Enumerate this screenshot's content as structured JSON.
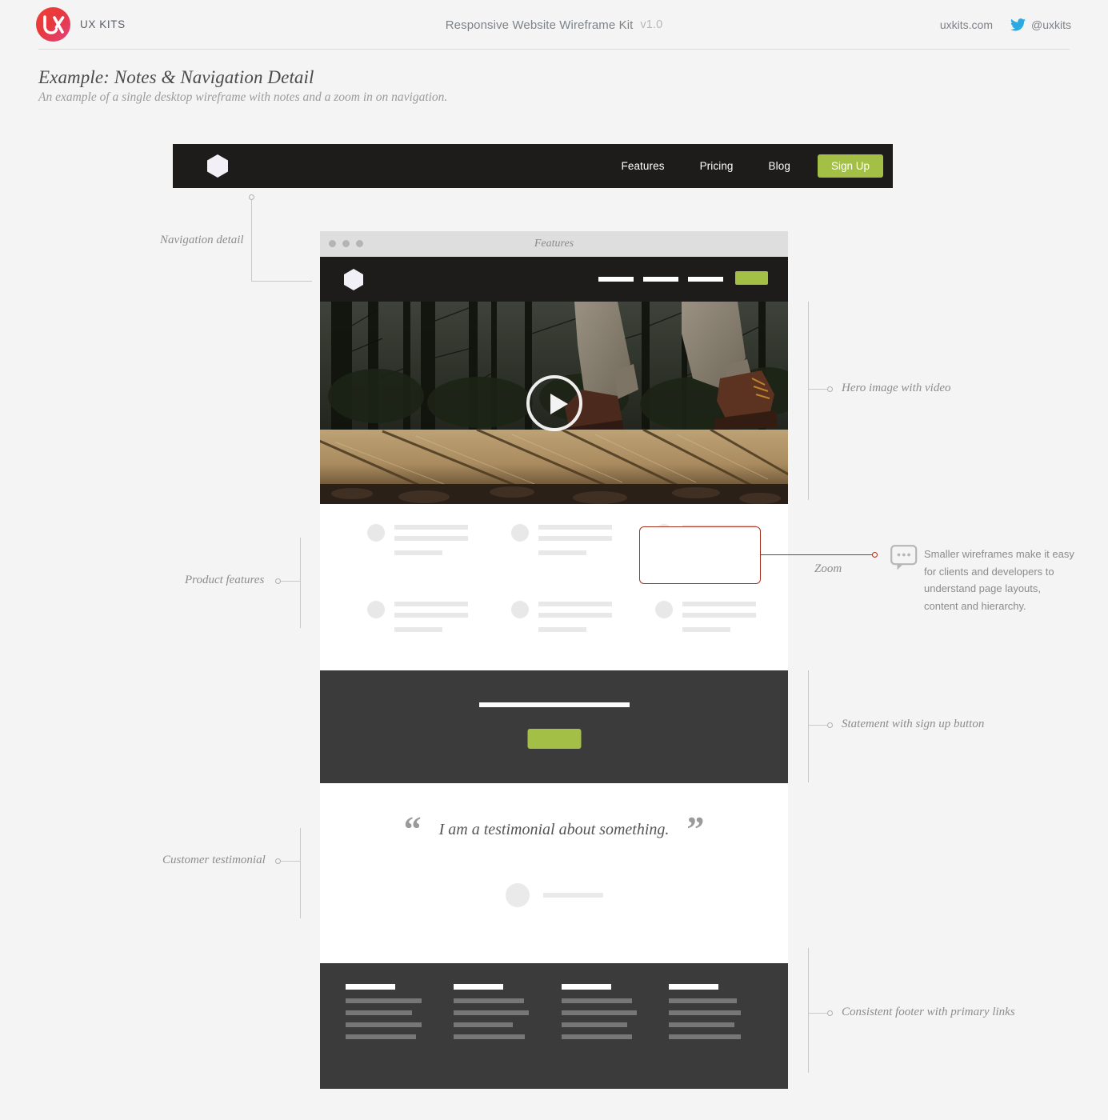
{
  "topbar": {
    "brand": "UX KITS",
    "kit_title": "Responsive Website Wireframe Kit",
    "version": "v1.0",
    "website": "uxkits.com",
    "twitter_handle": "@uxkits"
  },
  "page": {
    "title": "Example: Notes & Navigation Detail",
    "subtitle": "An example of a single desktop wireframe with notes and a zoom in on navigation."
  },
  "nav_detail": {
    "links": [
      "Features",
      "Pricing",
      "Blog"
    ],
    "cta": "Sign Up"
  },
  "browser": {
    "window_title": "Features"
  },
  "annotations": {
    "navigation_detail": "Navigation detail",
    "hero": "Hero image with video",
    "product_features": "Product features",
    "zoom": "Zoom",
    "statement": "Statement with sign up button",
    "testimonial": "Customer testimonial",
    "footer": "Consistent footer with primary links"
  },
  "note": {
    "lines": [
      "Smaller wireframes make it easy",
      "for clients and developers to",
      "understand page layouts,",
      "content and hierarchy."
    ]
  },
  "testimonial": {
    "open_quote": "“",
    "close_quote": "”",
    "text": "I am a testimonial about something."
  },
  "colors": {
    "accent_green": "#a3bf45",
    "highlight_red": "#a8321e",
    "dark_nav": "#1d1c1a",
    "dark_section": "#3b3b3b",
    "twitter_blue": "#2ba9e1",
    "page_bg": "#f4f4f4"
  }
}
